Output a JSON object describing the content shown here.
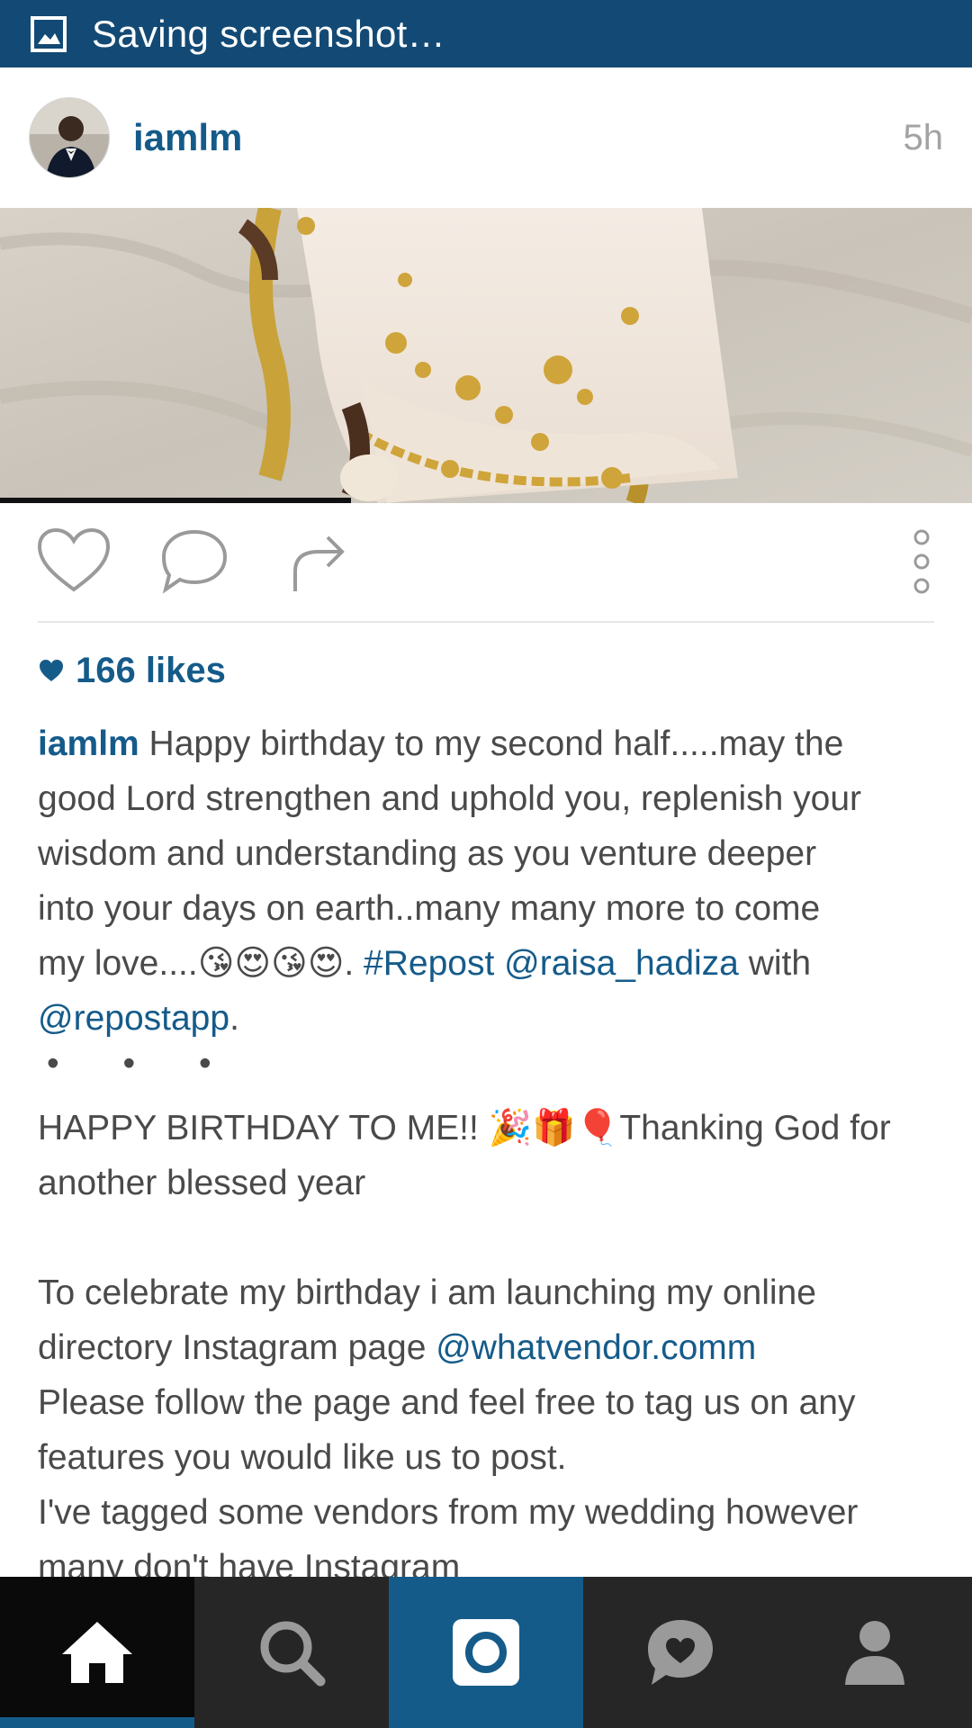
{
  "status_bar": {
    "text": "Saving screenshot…",
    "icon": "image-icon",
    "background": "#134a75"
  },
  "post": {
    "username": "iamlm",
    "time": "5h",
    "likes": "166 likes",
    "caption": {
      "user": "iamlm",
      "line1_text": " Happy birthday to my second half.....may the",
      "line2": "good Lord strengthen and uphold you, replenish your",
      "line3": "wisdom and understanding  as you venture deeper",
      "line4": "into your days on earth..many many more to come",
      "line5_text": "my love....",
      "line5_emoji": "😘😍😘😍",
      "line5_dot": ". ",
      "hashtag": "#Repost",
      "mention1": "@raisa_hadiza",
      "with": " with",
      "mention2": "@repostapp",
      "mention2_end": ".",
      "dots": "• • •",
      "line7_text": "HAPPY BIRTHDAY TO ME!! ",
      "line7_emoji": "🎉🎁🎈",
      "line7_end": "Thanking God for",
      "line8": "another blessed year",
      "line9": "To celebrate my birthday i am launching my online",
      "line10_text": "directory Instagram page ",
      "line10_link": "@whatvendor.comm",
      "line11": "Please follow the page and feel free to tag us on any",
      "line12": "features you would like us to post.",
      "line13": "I've tagged some vendors from my wedding however",
      "line14": "many don't have Instagram"
    }
  },
  "actions": {
    "like_icon": "heart-outline-icon",
    "comment_icon": "comment-bubble-icon",
    "share_icon": "share-arrow-icon",
    "more_icon": "more-vertical-icon"
  },
  "bottom_nav": {
    "items": [
      {
        "icon": "home-icon",
        "active": true
      },
      {
        "icon": "search-icon"
      },
      {
        "icon": "camera-icon"
      },
      {
        "icon": "activity-heart-icon"
      },
      {
        "icon": "profile-icon"
      }
    ]
  },
  "colors": {
    "accent": "#155b8a",
    "text": "#4a4a4a",
    "muted": "#a3a3a3",
    "nav_background": "#262626"
  }
}
